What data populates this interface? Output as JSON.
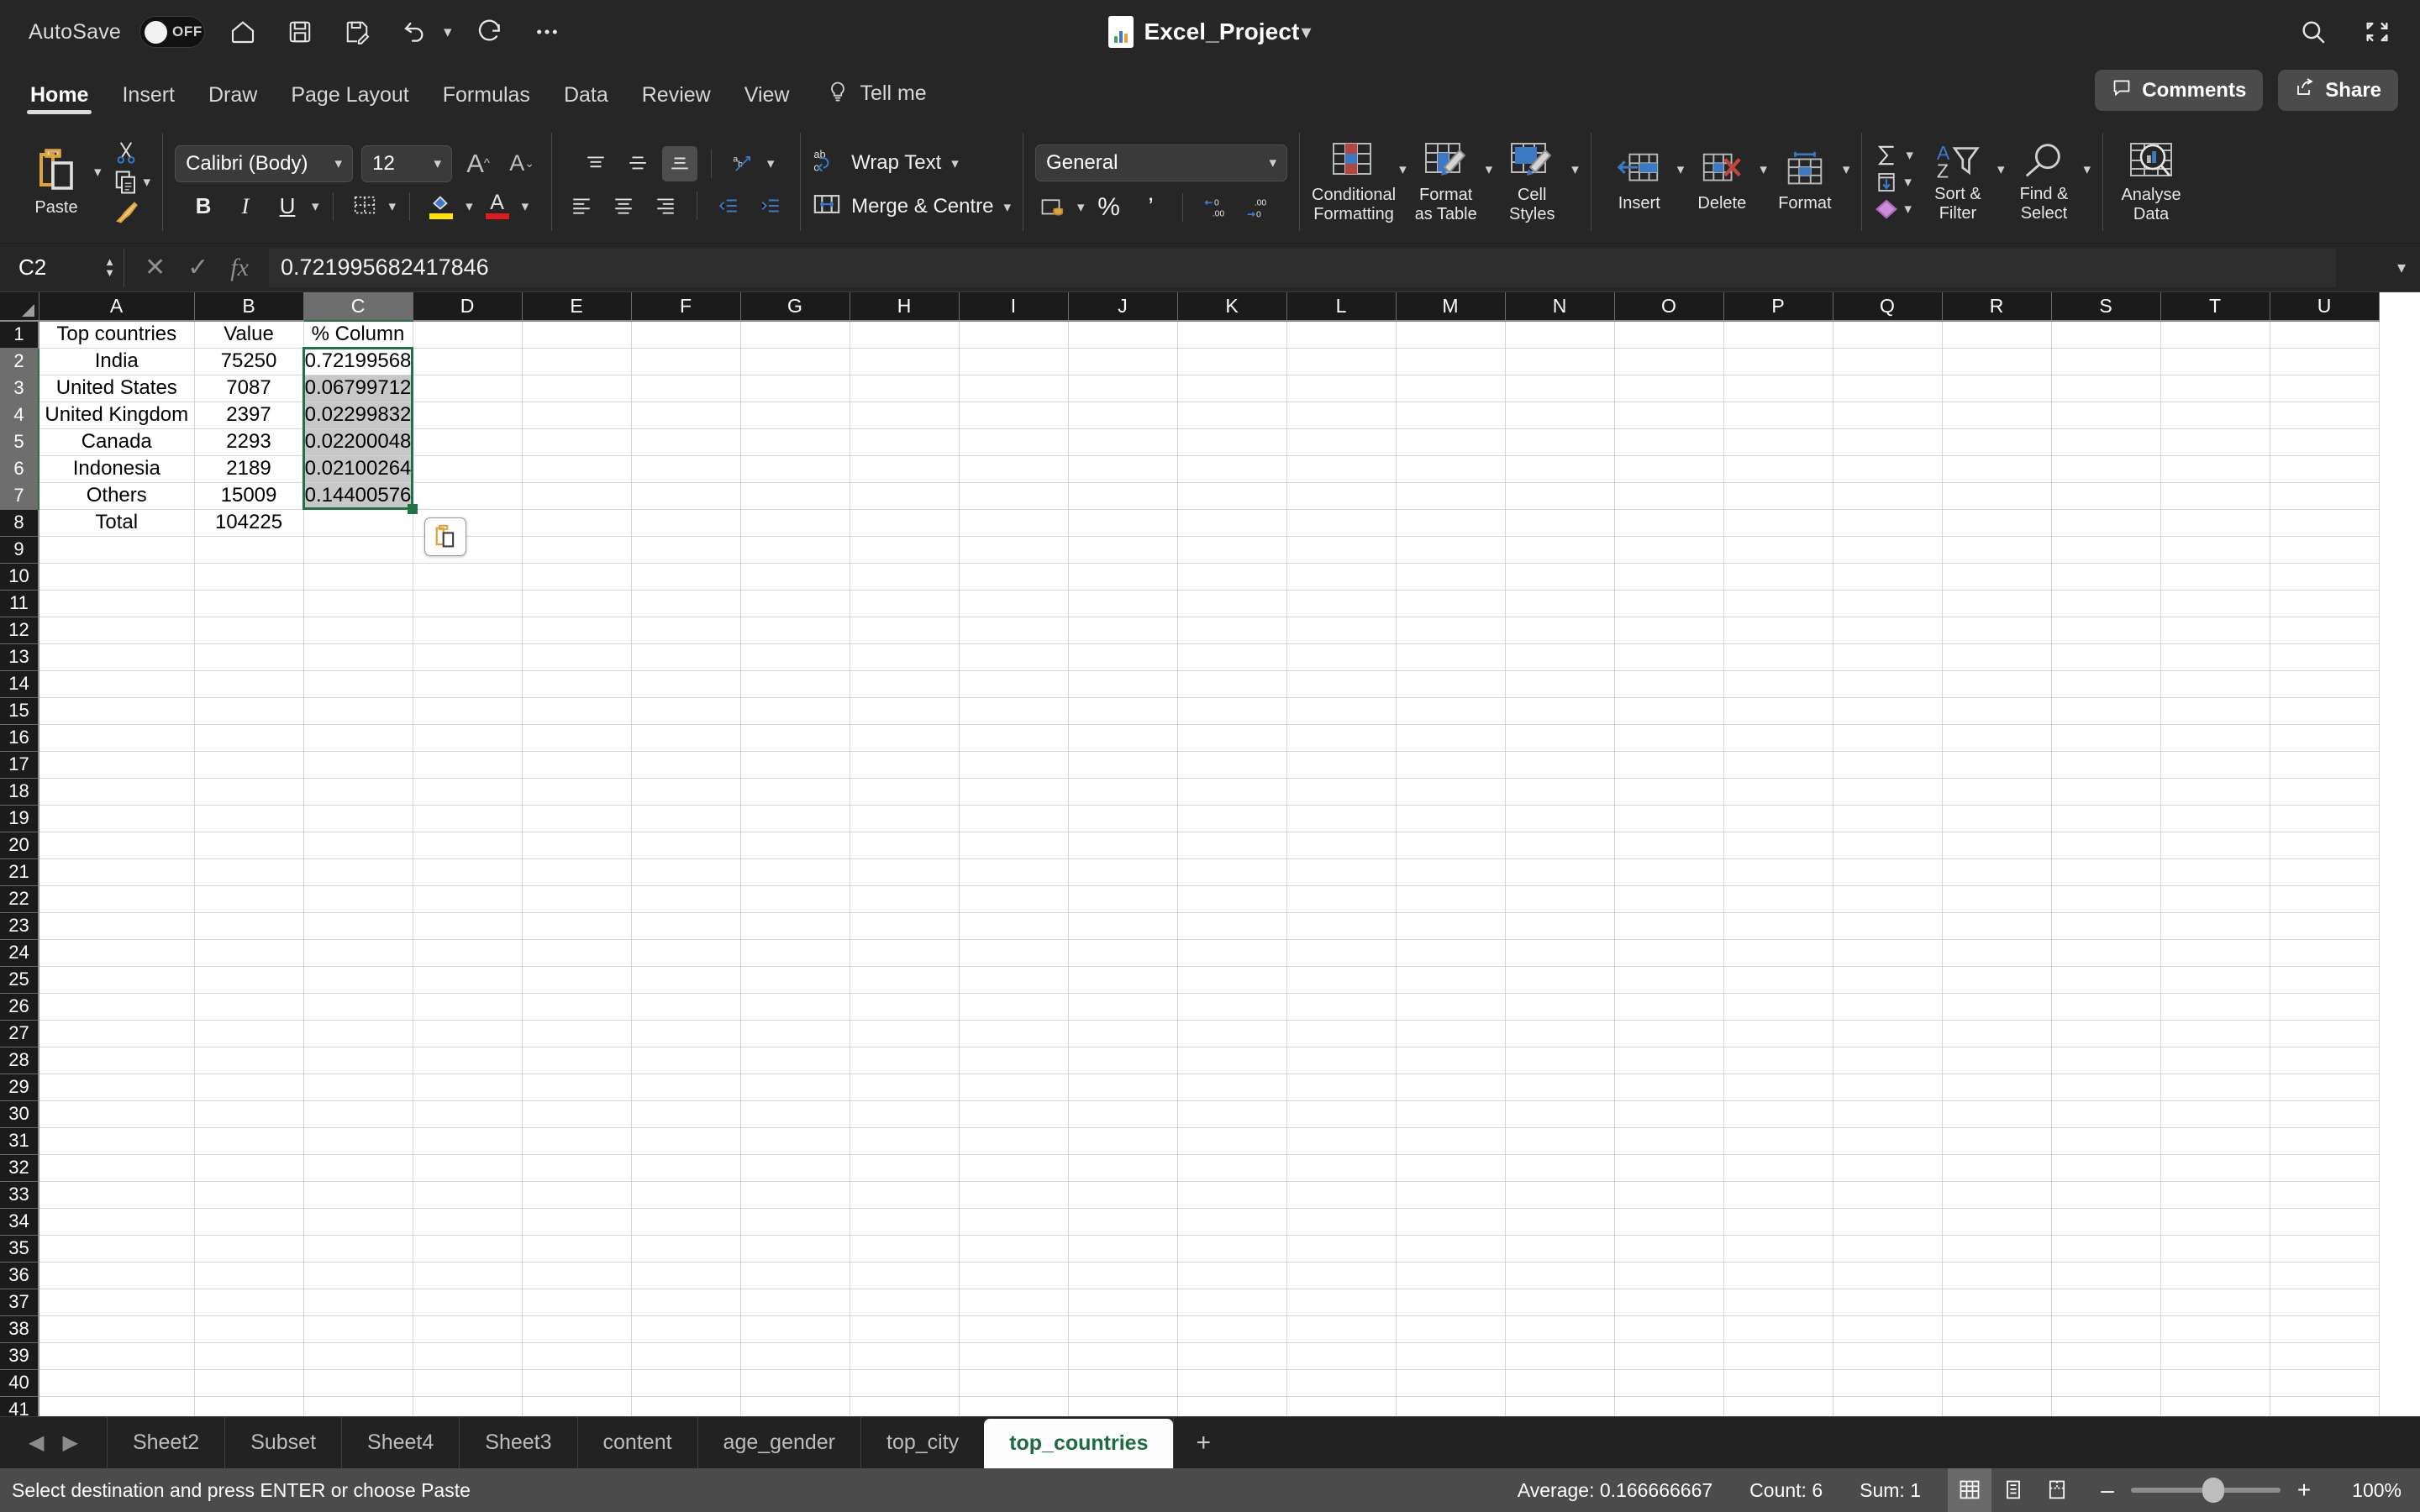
{
  "titlebar": {
    "autosave_label": "AutoSave",
    "autosave_state": "OFF",
    "document_title": "Excel_Project",
    "quick_access": [
      {
        "name": "home-icon",
        "label": "Home"
      },
      {
        "name": "save-icon",
        "label": "Save"
      },
      {
        "name": "save-as-icon",
        "label": "Save As"
      },
      {
        "name": "undo-icon",
        "label": "Undo"
      },
      {
        "name": "redo-icon",
        "label": "Redo"
      },
      {
        "name": "more-icon",
        "label": "More"
      }
    ],
    "right_icons": [
      {
        "name": "search-icon",
        "label": "Search"
      },
      {
        "name": "ribbon-display-icon",
        "label": "Ribbon Display Options"
      }
    ]
  },
  "ribbon_tabs": {
    "tabs": [
      {
        "label": "Home",
        "active": true
      },
      {
        "label": "Insert",
        "active": false
      },
      {
        "label": "Draw",
        "active": false
      },
      {
        "label": "Page Layout",
        "active": false
      },
      {
        "label": "Formulas",
        "active": false
      },
      {
        "label": "Data",
        "active": false
      },
      {
        "label": "Review",
        "active": false
      },
      {
        "label": "View",
        "active": false
      }
    ],
    "tell_me": "Tell me",
    "comments": "Comments",
    "share": "Share"
  },
  "ribbon": {
    "clipboard": {
      "paste_label": "Paste",
      "cut_label": "Cut",
      "copy_label": "Copy",
      "format_painter_label": "Format Painter"
    },
    "font": {
      "font_name": "Calibri (Body)",
      "font_size": "12",
      "grow_label": "Increase Font Size",
      "shrink_label": "Decrease Font Size",
      "bold": "B",
      "italic": "I",
      "underline": "U",
      "borders_label": "Borders",
      "fill_color_label": "Fill Color",
      "fill_color": "#ffe600",
      "font_color_label": "Font Color",
      "font_color": "#e01b1b"
    },
    "alignment": {
      "top_align": "Top Align",
      "middle_align": "Middle Align",
      "bottom_align": "Bottom Align",
      "orientation": "Orientation",
      "align_left": "Align Left",
      "align_center": "Center",
      "align_right": "Align Right",
      "decrease_indent": "Decrease Indent",
      "increase_indent": "Increase Indent",
      "wrap_text": "Wrap Text",
      "merge_centre": "Merge & Centre"
    },
    "number": {
      "format": "General",
      "accounting_label": "Accounting Number Format",
      "percent_label": "Percent Style",
      "comma_label": "Comma Style",
      "increase_decimal": "Increase Decimal",
      "decrease_decimal": "Decrease Decimal"
    },
    "styles": [
      {
        "label_top": "Conditional",
        "label_bottom": "Formatting",
        "name": "conditional-formatting"
      },
      {
        "label_top": "Format",
        "label_bottom": "as Table",
        "name": "format-as-table"
      },
      {
        "label_top": "Cell",
        "label_bottom": "Styles",
        "name": "cell-styles"
      }
    ],
    "cells": [
      {
        "label": "Insert",
        "name": "insert-cells"
      },
      {
        "label": "Delete",
        "name": "delete-cells"
      },
      {
        "label": "Format",
        "name": "format-cells"
      }
    ],
    "editing": {
      "autosum": "AutoSum",
      "fill": "Fill",
      "clear": "Clear",
      "sort_filter_top": "Sort &",
      "sort_filter_bottom": "Filter",
      "find_select_top": "Find &",
      "find_select_bottom": "Select"
    },
    "analyse": {
      "label_top": "Analyse",
      "label_bottom": "Data"
    }
  },
  "formula_bar": {
    "name_box": "C2",
    "cancel": "✕",
    "enter": "✓",
    "fx": "fx",
    "value": "0.721995682417846"
  },
  "grid": {
    "columns": [
      "A",
      "B",
      "C",
      "D",
      "E",
      "F",
      "G",
      "H",
      "I",
      "J",
      "K",
      "L",
      "M",
      "N",
      "O",
      "P",
      "Q",
      "R",
      "S",
      "T",
      "U"
    ],
    "selected_column": "C",
    "rows": [
      1,
      2,
      3,
      4,
      5,
      6,
      7,
      8,
      9,
      10,
      11,
      12,
      13,
      14,
      15,
      16,
      17,
      18,
      19,
      20,
      21,
      22,
      23,
      24,
      25,
      26,
      27,
      28,
      29,
      30,
      31,
      32,
      33,
      34,
      35,
      36,
      37,
      38,
      39,
      40,
      41
    ],
    "selected_rows": [
      2,
      3,
      4,
      5,
      6,
      7
    ],
    "data": [
      {
        "row": 1,
        "A": "Top countries",
        "B": "Value",
        "C": "% Column"
      },
      {
        "row": 2,
        "A": "India",
        "B": "75250",
        "C": "0.72199568"
      },
      {
        "row": 3,
        "A": "United States",
        "B": "7087",
        "C": "0.06799712"
      },
      {
        "row": 4,
        "A": "United Kingdom",
        "B": "2397",
        "C": "0.02299832"
      },
      {
        "row": 5,
        "A": "Canada",
        "B": "2293",
        "C": "0.02200048"
      },
      {
        "row": 6,
        "A": "Indonesia",
        "B": "2189",
        "C": "0.02100264"
      },
      {
        "row": 7,
        "A": "Others",
        "B": "15009",
        "C": "0.14400576"
      },
      {
        "row": 8,
        "A": "Total",
        "B": "104225",
        "C": ""
      }
    ],
    "copied_range": "C2:C7",
    "active_cell": "C2",
    "paste_options_label": "Paste Options",
    "marquee_color": "#217346"
  },
  "sheet_tabs": {
    "tabs": [
      {
        "label": "Sheet2",
        "active": false
      },
      {
        "label": "Subset",
        "active": false
      },
      {
        "label": "Sheet4",
        "active": false
      },
      {
        "label": "Sheet3",
        "active": false
      },
      {
        "label": "content",
        "active": false
      },
      {
        "label": "age_gender",
        "active": false
      },
      {
        "label": "top_city",
        "active": false
      },
      {
        "label": "top_countries",
        "active": true
      }
    ],
    "add_label": "+",
    "prev_label": "◀",
    "next_label": "▶"
  },
  "status_bar": {
    "message": "Select destination and press ENTER or choose Paste",
    "average": "Average: 0.166666667",
    "count": "Count: 6",
    "sum": "Sum: 1",
    "views": [
      {
        "name": "normal-view-icon",
        "active": true
      },
      {
        "name": "page-layout-view-icon",
        "active": false
      },
      {
        "name": "page-break-view-icon",
        "active": false
      }
    ],
    "zoom_out": "–",
    "zoom_in": "+",
    "zoom_level": "100%"
  }
}
